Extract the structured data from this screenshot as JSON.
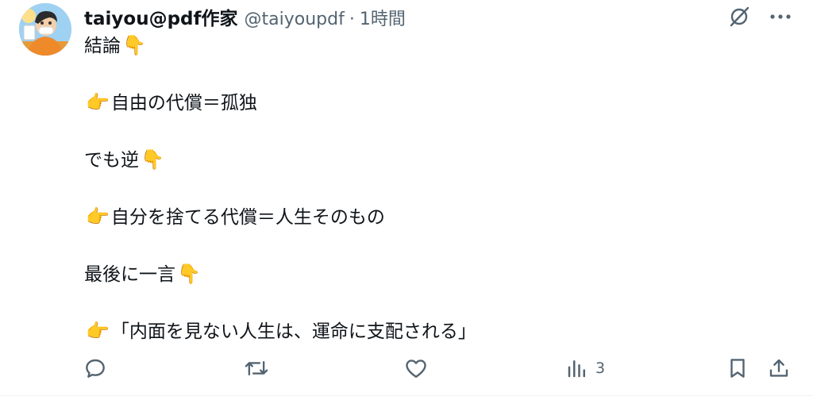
{
  "author": {
    "display_name": "taiyou@pdf作家",
    "handle": "@taiyoupdf",
    "separator": "·",
    "time": "1時間"
  },
  "post": {
    "lines": [
      {
        "text": "結論",
        "emoji": "👇"
      },
      {
        "text": "",
        "emoji": ""
      },
      {
        "text": "自由の代償＝孤独",
        "emoji": "👉"
      },
      {
        "text": "",
        "emoji": ""
      },
      {
        "text": "でも逆",
        "emoji": "👇"
      },
      {
        "text": "",
        "emoji": ""
      },
      {
        "text": "自分を捨てる代償＝人生そのもの",
        "emoji": "👉"
      },
      {
        "text": "",
        "emoji": ""
      },
      {
        "text": "最後に一言",
        "emoji": "👇"
      },
      {
        "text": "",
        "emoji": ""
      },
      {
        "text": "「内面を見ない人生は、運命に支配される」",
        "emoji": "👉"
      }
    ]
  },
  "top_icons": [
    "grok-icon",
    "more-icon"
  ],
  "actions": {
    "reply": {
      "icon": "reply-icon",
      "count": ""
    },
    "repost": {
      "icon": "repost-icon",
      "count": ""
    },
    "like": {
      "icon": "heart-icon",
      "count": ""
    },
    "views": {
      "icon": "views-icon",
      "count": "3"
    },
    "bookmark": {
      "icon": "bookmark-icon",
      "count": ""
    },
    "share": {
      "icon": "share-icon",
      "count": ""
    }
  },
  "colors": {
    "text": "#0f1419",
    "secondary": "#536471",
    "divider": "#eff3f4"
  }
}
